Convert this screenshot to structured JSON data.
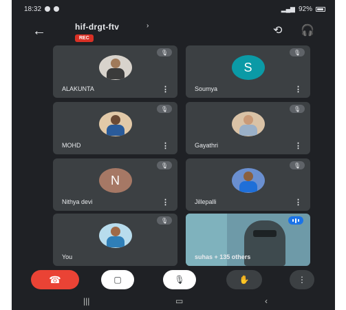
{
  "status_bar": {
    "time": "18:32",
    "right_text": "92%"
  },
  "header": {
    "meeting_code": "hif-drgt-ftv",
    "rec_label": "REC"
  },
  "participants": [
    {
      "name": "ALAKUNTA",
      "avatar_type": "photo",
      "skin": "#a07a5a",
      "shirt": "#3b3b3b",
      "bg": "#d8d3cc"
    },
    {
      "name": "Soumya",
      "avatar_type": "initial",
      "initial": "S",
      "bg": "#0b9aa6"
    },
    {
      "name": "MOHD",
      "avatar_type": "photo",
      "skin": "#6b4a35",
      "shirt": "#2a5b9a",
      "bg": "#e2c9a8"
    },
    {
      "name": "Gayathri",
      "avatar_type": "photo",
      "skin": "#c99a78",
      "shirt": "#9ab0c8",
      "bg": "#d9c2a6"
    },
    {
      "name": "Nithya devi",
      "avatar_type": "initial",
      "initial": "N",
      "bg": "#a67865"
    },
    {
      "name": "Jillepalli",
      "avatar_type": "photo",
      "skin": "#8a6040",
      "shirt": "#1f6fd8",
      "bg": "#6a8fd0"
    },
    {
      "name": "You",
      "avatar_type": "photo",
      "skin": "#a06a48",
      "shirt": "#2f7fb8",
      "bg": "#b8dced"
    }
  ],
  "video_tile": {
    "label": "suhas + 135 others"
  },
  "controls": {
    "end_call_icon": "phone-hangup-icon",
    "camera_icon": "camera-off-icon",
    "mic_icon": "mic-off-icon",
    "hand_icon": "raise-hand-icon",
    "more_icon": "more-vertical-icon"
  },
  "colors": {
    "background": "#1f2125",
    "tile": "#3c4043",
    "end_call": "#ea4335",
    "rec": "#d93025",
    "speaking": "#1a73e8"
  }
}
